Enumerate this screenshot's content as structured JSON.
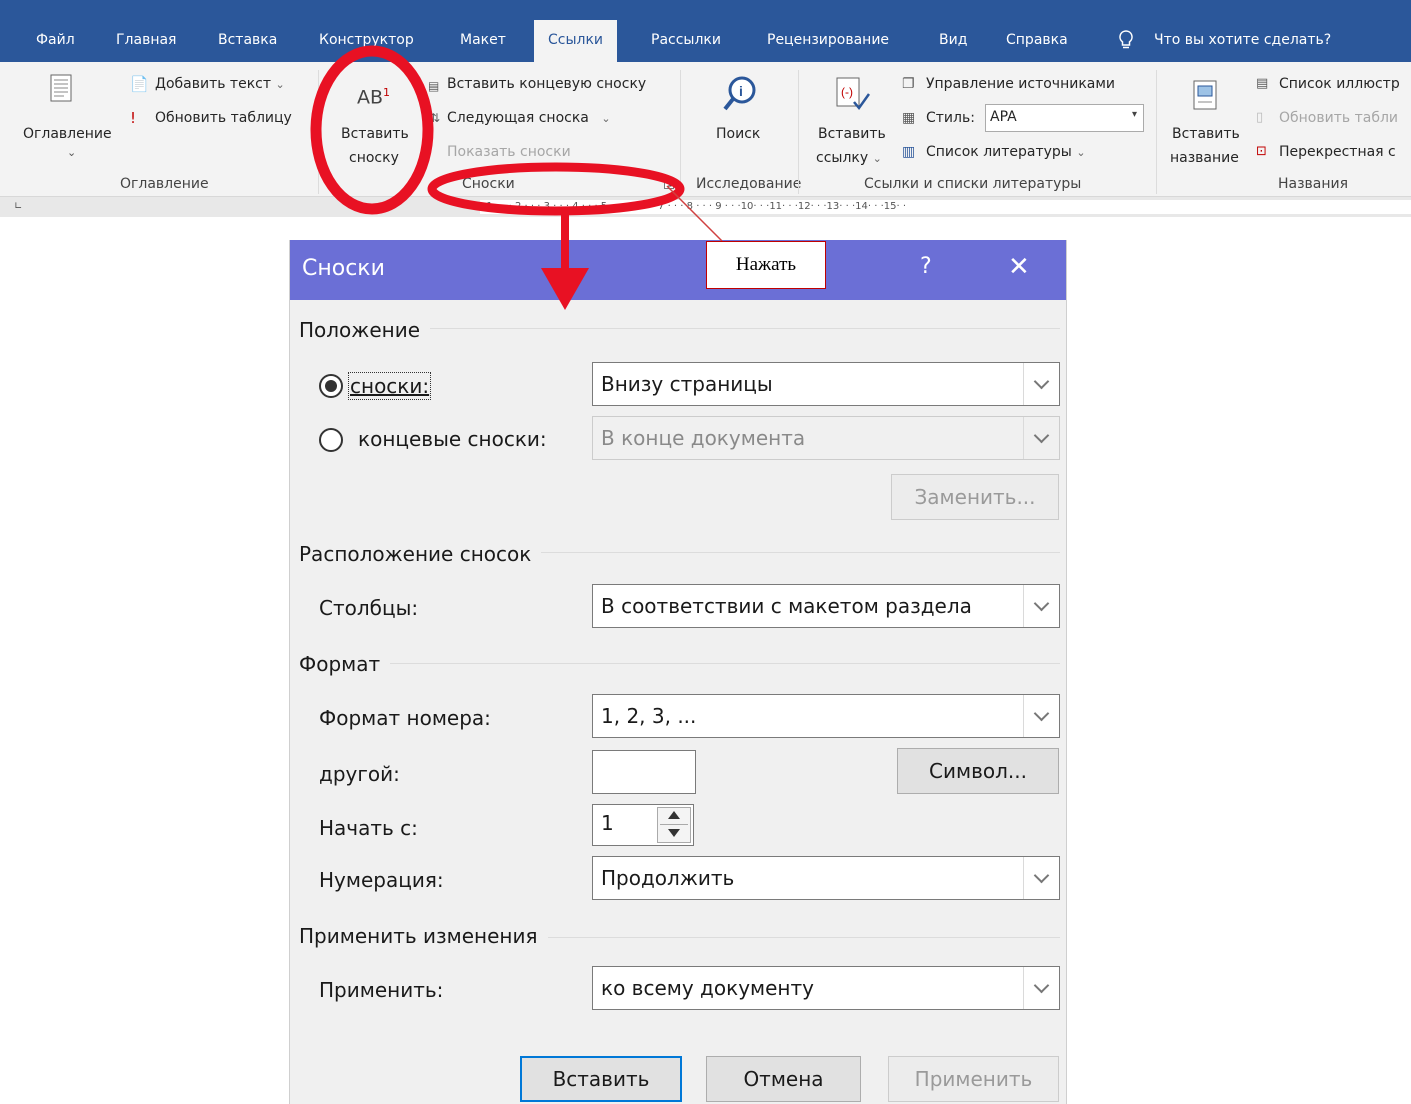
{
  "ribbon": {
    "tabs": [
      "Файл",
      "Главная",
      "Вставка",
      "Конструктор",
      "Макет",
      "Ссылки",
      "Рассылки",
      "Рецензирование",
      "Вид",
      "Справка"
    ],
    "active_tab": "Ссылки",
    "tell_me": "Что вы хотите сделать?",
    "toc": {
      "button": "Оглавление",
      "add_text": "Добавить текст",
      "update_table": "Обновить таблицу",
      "group": "Оглавление"
    },
    "footnotes": {
      "insert_ab": "AB",
      "insert_sup": "1",
      "insert_line1": "Вставить",
      "insert_line2": "сноску",
      "insert_endnote": "Вставить концевую сноску",
      "next_footnote": "Следующая сноска",
      "show_notes": "Показать сноски",
      "group": "Сноски"
    },
    "research": {
      "search": "Поиск",
      "group": "Исследование"
    },
    "citations": {
      "insert_line1": "Вставить",
      "insert_line2": "ссылку",
      "manage_sources": "Управление источниками",
      "style_label": "Стиль:",
      "style_value": "APA",
      "bibliography": "Список литературы",
      "group": "Ссылки и списки литературы"
    },
    "captions": {
      "insert_line1": "Вставить",
      "insert_line2": "название",
      "list_illustrations": "Список иллюстр",
      "update_table": "Обновить табли",
      "cross_ref": "Перекрестная с",
      "group": "Названия"
    }
  },
  "ruler": {
    "text": "· 1 · · · 2 · · · 3 · · · 4 · · · 5 · · · 6 · · · 7 · · · 8 · · · 9 · · ·10· · ·11· · ·12· · ·13· · ·14· · ·15· ·"
  },
  "annotation": {
    "label": "Нажать"
  },
  "dialog": {
    "title": "Сноски",
    "help": "?",
    "close": "✕",
    "position": {
      "section": "Положение",
      "footnotes_label": "сноски:",
      "footnotes_value": "Внизу страницы",
      "endnotes_label": "концевые сноски:",
      "endnotes_value": "В конце документа",
      "replace_button": "Заменить..."
    },
    "layout": {
      "section": "Расположение сносок",
      "columns_label": "Столбцы:",
      "columns_value": "В соответствии с макетом раздела"
    },
    "format": {
      "section": "Формат",
      "number_format_label": "Формат номера:",
      "number_format_value": "1, 2, 3, ...",
      "custom_label": "другой:",
      "custom_value": "",
      "symbol_button": "Символ...",
      "start_label": "Начать с:",
      "start_value": "1",
      "numbering_label": "Нумерация:",
      "numbering_value": "Продолжить"
    },
    "apply": {
      "section": "Применить изменения",
      "apply_label": "Применить:",
      "apply_value": "ко всему документу"
    },
    "buttons": {
      "insert": "Вставить",
      "cancel": "Отмена",
      "apply": "Применить"
    }
  }
}
